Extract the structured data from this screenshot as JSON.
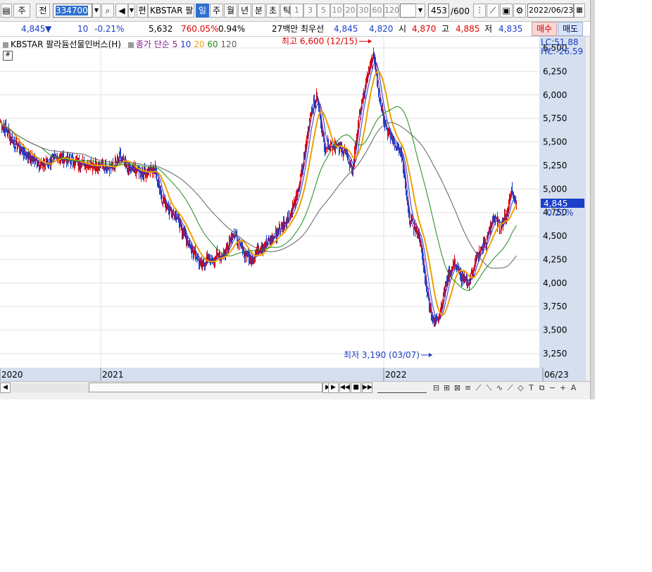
{
  "toolbar": {
    "market_type": "주",
    "prev_label": "전",
    "code": "334700",
    "edit_label": "편",
    "name_short": "KBSTAR 팔다",
    "periods": [
      "일",
      "주",
      "월",
      "년",
      "분",
      "초",
      "틱"
    ],
    "active_period": "일",
    "intervals": [
      "1",
      "3",
      "5",
      "10",
      "20",
      "30",
      "60",
      "120"
    ],
    "count_value": "453",
    "count_total": "/600",
    "date": "2022/06/23"
  },
  "quote": {
    "price": "4,845",
    "change_arrow": "▼",
    "change": "10",
    "change_pct": "-0.21%",
    "volume": "5,632",
    "volume_ratio": "760.05%",
    "turnover": "0.94%",
    "amount": "27백만",
    "best_label": "최우선",
    "best_sell": "4,845",
    "best_buy": "4,820",
    "open_label": "시",
    "open": "4,870",
    "high_label": "고",
    "high": "4,885",
    "low_label": "저",
    "low": "4,835",
    "buy_button": "매수",
    "sell_button": "매도"
  },
  "legend": {
    "title": "KBSTAR 팔라듐선물인버스(H)",
    "ma_prefix": "종가 단순",
    "ma_periods": [
      "5",
      "10",
      "20",
      "60",
      "120"
    ]
  },
  "chart_data": {
    "type": "candlestick",
    "title": "KBSTAR 팔라듐선물인버스(H)",
    "y_ticks": [
      6500,
      6250,
      6000,
      5750,
      5500,
      5250,
      5000,
      4750,
      4500,
      4250,
      4000,
      3750,
      3500,
      3250
    ],
    "y_tick_labels": [
      "6,500",
      "6,250",
      "6,000",
      "5,750",
      "5,500",
      "5,250",
      "5,000",
      "4,750",
      "4,500",
      "4,250",
      "4,000",
      "3,750",
      "3,500",
      "3,250"
    ],
    "ylim": [
      3100,
      6620
    ],
    "x_labels": [
      "2020",
      "2021",
      "2022",
      "06/23"
    ],
    "corner_labels": [
      "LC:51.88",
      "HC:-26.59"
    ],
    "current_price_label": "4,845",
    "current_change_label": "-0.21%",
    "current_price": 4845,
    "max_annotation": "최고 6,600 (12/15)",
    "min_annotation": "최저 3,190 (03/07)",
    "max_value": 6600,
    "min_value": 3190,
    "close_anchors": [
      [
        0,
        5720
      ],
      [
        20,
        5480
      ],
      [
        40,
        5350
      ],
      [
        60,
        5250
      ],
      [
        80,
        5340
      ],
      [
        100,
        5300
      ],
      [
        120,
        5270
      ],
      [
        140,
        5260
      ],
      [
        160,
        5230
      ],
      [
        170,
        5340
      ],
      [
        180,
        5220
      ],
      [
        200,
        5180
      ],
      [
        220,
        5200
      ],
      [
        230,
        4880
      ],
      [
        250,
        4700
      ],
      [
        270,
        4370
      ],
      [
        285,
        4200
      ],
      [
        300,
        4250
      ],
      [
        320,
        4330
      ],
      [
        330,
        4550
      ],
      [
        340,
        4380
      ],
      [
        355,
        4260
      ],
      [
        370,
        4380
      ],
      [
        390,
        4500
      ],
      [
        410,
        4720
      ],
      [
        420,
        4880
      ],
      [
        430,
        5250
      ],
      [
        440,
        5800
      ],
      [
        450,
        5980
      ],
      [
        460,
        5450
      ],
      [
        475,
        5480
      ],
      [
        490,
        5380
      ],
      [
        500,
        5200
      ],
      [
        510,
        5780
      ],
      [
        520,
        6150
      ],
      [
        530,
        6450
      ],
      [
        540,
        5900
      ],
      [
        550,
        5600
      ],
      [
        560,
        5480
      ],
      [
        570,
        5350
      ],
      [
        580,
        4700
      ],
      [
        595,
        4500
      ],
      [
        605,
        3950
      ],
      [
        615,
        3560
      ],
      [
        625,
        3700
      ],
      [
        635,
        4050
      ],
      [
        645,
        4220
      ],
      [
        655,
        4050
      ],
      [
        665,
        4000
      ],
      [
        675,
        4250
      ],
      [
        690,
        4450
      ],
      [
        700,
        4700
      ],
      [
        710,
        4600
      ],
      [
        720,
        4750
      ],
      [
        725,
        5000
      ],
      [
        730,
        4880
      ],
      [
        733,
        4845
      ]
    ]
  },
  "colors": {
    "up": "#e00000",
    "down": "#1a3fc8",
    "ma5": "#8b1a8b",
    "ma10": "#1a3fc8",
    "ma20": "#f0a000",
    "ma60": "#1b8a1b",
    "ma120": "#606060",
    "axis_bg": "#d5dff0"
  }
}
